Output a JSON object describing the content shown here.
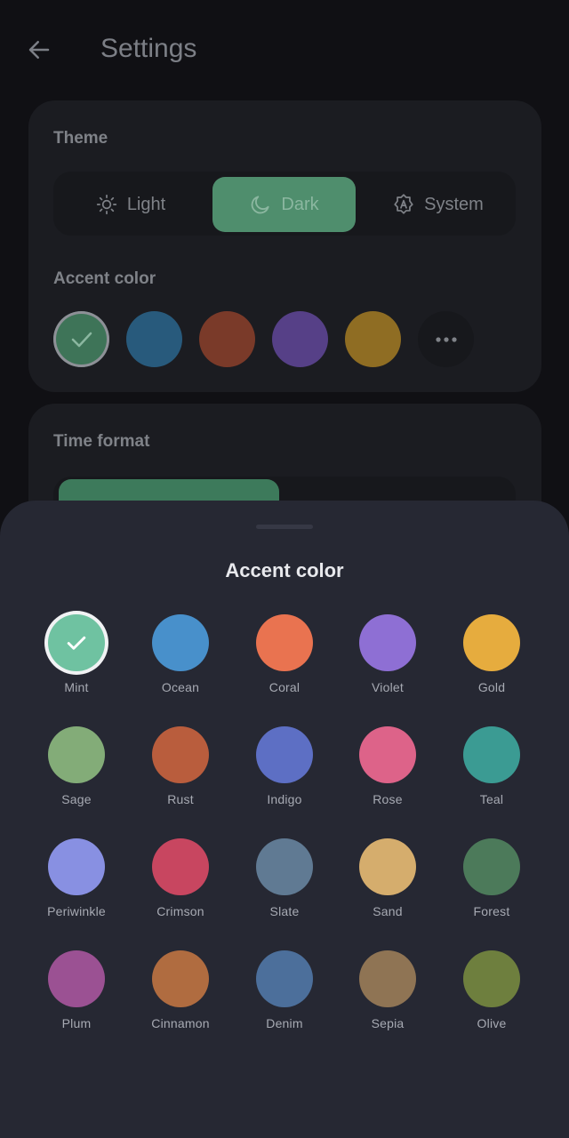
{
  "appbar": {
    "title": "Settings",
    "back_icon": "arrow-back-icon"
  },
  "theme_card": {
    "title": "Theme",
    "options": [
      {
        "label": "Light",
        "icon": "sun-icon",
        "active": false
      },
      {
        "label": "Dark",
        "icon": "moon-icon",
        "active": true
      },
      {
        "label": "System",
        "icon": "auto-mode-icon",
        "active": false
      }
    ],
    "accent_title": "Accent color",
    "swatches": [
      "#3e7458",
      "#285a7c",
      "#7a3a29",
      "#564087",
      "#8f6d23"
    ],
    "selected_swatch": 0,
    "more_icon": "more-horizontal-icon"
  },
  "time_card": {
    "title": "Time format"
  },
  "sheet": {
    "title": "Accent color",
    "selected": "Mint",
    "colors": [
      {
        "name": "Mint",
        "hex": "#6fc2a1"
      },
      {
        "name": "Ocean",
        "hex": "#4890cb"
      },
      {
        "name": "Coral",
        "hex": "#e97350"
      },
      {
        "name": "Violet",
        "hex": "#8e6fd4"
      },
      {
        "name": "Gold",
        "hex": "#e6ac3e"
      },
      {
        "name": "Sage",
        "hex": "#83ac78"
      },
      {
        "name": "Rust",
        "hex": "#b95d3d"
      },
      {
        "name": "Indigo",
        "hex": "#5d6fc4"
      },
      {
        "name": "Rose",
        "hex": "#dd6389"
      },
      {
        "name": "Teal",
        "hex": "#3b9b93"
      },
      {
        "name": "Periwinkle",
        "hex": "#8890e2"
      },
      {
        "name": "Crimson",
        "hex": "#c84660"
      },
      {
        "name": "Slate",
        "hex": "#607a93"
      },
      {
        "name": "Sand",
        "hex": "#d5ad6d"
      },
      {
        "name": "Forest",
        "hex": "#4c7a5a"
      },
      {
        "name": "Plum",
        "hex": "#9b5193"
      },
      {
        "name": "Cinnamon",
        "hex": "#b06c40"
      },
      {
        "name": "Denim",
        "hex": "#4c6f9b"
      },
      {
        "name": "Sepia",
        "hex": "#8f7454"
      },
      {
        "name": "Olive",
        "hex": "#6e7f3e"
      }
    ]
  }
}
